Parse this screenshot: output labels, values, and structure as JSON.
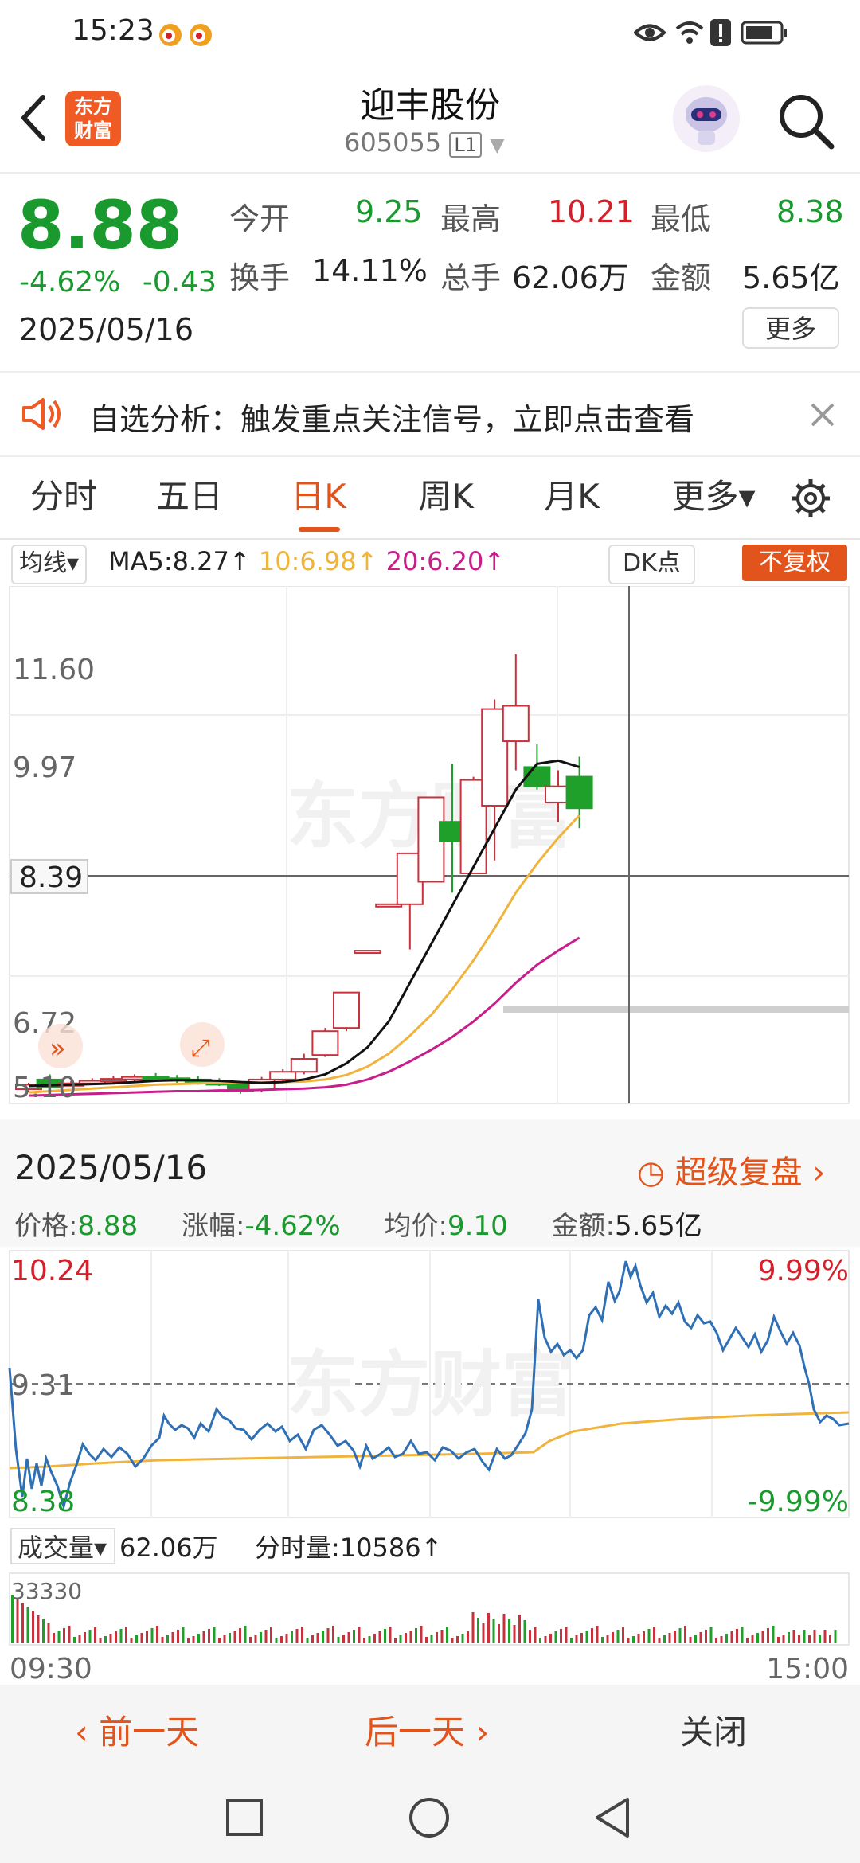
{
  "status_bar": {
    "time": "15:23"
  },
  "header": {
    "title": "迎丰股份",
    "code": "605055",
    "level": "L1",
    "logo_text": [
      "东方",
      "财富"
    ]
  },
  "quote": {
    "price": "8.88",
    "change_pct": "-4.62%",
    "change": "-0.43",
    "date": "2025/05/16",
    "open_label": "今开",
    "open": "9.25",
    "high_label": "最高",
    "high": "10.21",
    "low_label": "最低",
    "low": "8.38",
    "turnover_label": "换手",
    "turnover": "14.11%",
    "volume_label": "总手",
    "volume": "62.06万",
    "amount_label": "金额",
    "amount": "5.65亿",
    "more_button": "更多"
  },
  "notice": {
    "text": "自选分析：触发重点关注信号，立即点击查看"
  },
  "tabs": [
    {
      "label": "分时",
      "active": false
    },
    {
      "label": "五日",
      "active": false
    },
    {
      "label": "日K",
      "active": true
    },
    {
      "label": "周K",
      "active": false
    },
    {
      "label": "月K",
      "active": false
    },
    {
      "label": "更多▾",
      "active": false
    }
  ],
  "kline": {
    "indicator_select": "均线▾",
    "ma5": "MA5:8.27↑",
    "ma10": "10:6.98↑",
    "ma20": "20:6.20↑",
    "dk_button": "DK点",
    "adjust_badge": "不复权",
    "watermark": "东方财富",
    "price_labels": [
      "11.60",
      "9.97",
      "8.39",
      "6.72",
      "5.10"
    ],
    "colors": {
      "up": "#c8323c",
      "down": "#1fa02b",
      "ma5": "#111111",
      "ma10": "#f0b43c",
      "ma20": "#c81e8c"
    }
  },
  "chart_data": {
    "type": "candlestick",
    "y_axis_labels": [
      11.6,
      9.97,
      8.39,
      6.72,
      5.1
    ],
    "crosshair_price": 8.39,
    "candles": [
      {
        "o": 5.05,
        "h": 5.15,
        "l": 5.0,
        "c": 5.12
      },
      {
        "o": 5.2,
        "h": 5.28,
        "l": 5.05,
        "c": 5.08
      },
      {
        "o": 5.12,
        "h": 5.18,
        "l": 5.1,
        "c": 5.14
      },
      {
        "o": 5.14,
        "h": 5.22,
        "l": 5.12,
        "c": 5.18
      },
      {
        "o": 5.18,
        "h": 5.26,
        "l": 5.15,
        "c": 5.21
      },
      {
        "o": 5.21,
        "h": 5.28,
        "l": 5.17,
        "c": 5.24
      },
      {
        "o": 5.24,
        "h": 5.3,
        "l": 5.18,
        "c": 5.22
      },
      {
        "o": 5.22,
        "h": 5.27,
        "l": 5.15,
        "c": 5.2
      },
      {
        "o": 5.2,
        "h": 5.25,
        "l": 5.12,
        "c": 5.16
      },
      {
        "o": 5.16,
        "h": 5.22,
        "l": 5.1,
        "c": 5.12
      },
      {
        "o": 5.12,
        "h": 5.18,
        "l": 4.98,
        "c": 5.02
      },
      {
        "o": 5.04,
        "h": 5.24,
        "l": 5.0,
        "c": 5.2
      },
      {
        "o": 5.2,
        "h": 5.36,
        "l": 5.16,
        "c": 5.32
      },
      {
        "o": 5.32,
        "h": 5.6,
        "l": 5.28,
        "c": 5.52
      },
      {
        "o": 5.58,
        "h": 6.0,
        "l": 5.55,
        "c": 5.95
      },
      {
        "o": 6.0,
        "h": 6.55,
        "l": 5.95,
        "c": 6.55
      },
      {
        "o": 7.2,
        "h": 7.2,
        "l": 7.2,
        "c": 7.2
      },
      {
        "o": 7.92,
        "h": 7.92,
        "l": 7.92,
        "c": 7.92
      },
      {
        "o": 7.92,
        "h": 8.71,
        "l": 7.22,
        "c": 8.71
      },
      {
        "o": 8.27,
        "h": 9.58,
        "l": 8.27,
        "c": 9.58
      },
      {
        "o": 9.2,
        "h": 10.1,
        "l": 8.1,
        "c": 8.9
      },
      {
        "o": 8.4,
        "h": 9.9,
        "l": 8.4,
        "c": 9.85
      },
      {
        "o": 9.45,
        "h": 11.1,
        "l": 8.6,
        "c": 10.95
      },
      {
        "o": 10.45,
        "h": 11.8,
        "l": 10.0,
        "c": 11.0
      },
      {
        "o": 10.05,
        "h": 10.4,
        "l": 9.7,
        "c": 9.75
      },
      {
        "o": 9.5,
        "h": 10.0,
        "l": 9.2,
        "c": 9.75
      },
      {
        "o": 9.9,
        "h": 10.21,
        "l": 9.1,
        "c": 9.41
      }
    ],
    "ma5": [
      5.1,
      5.11,
      5.12,
      5.13,
      5.14,
      5.16,
      5.18,
      5.19,
      5.19,
      5.18,
      5.16,
      5.15,
      5.16,
      5.2,
      5.28,
      5.45,
      5.7,
      6.1,
      6.7,
      7.3,
      7.9,
      8.5,
      9.1,
      9.7,
      10.1,
      10.15,
      10.05
    ],
    "ma10": [
      5.0,
      5.02,
      5.04,
      5.06,
      5.08,
      5.1,
      5.12,
      5.13,
      5.14,
      5.15,
      5.15,
      5.15,
      5.16,
      5.17,
      5.2,
      5.27,
      5.4,
      5.6,
      5.88,
      6.2,
      6.6,
      7.05,
      7.55,
      8.1,
      8.55,
      8.95,
      9.3
    ],
    "ma20": [
      4.95,
      4.96,
      4.97,
      4.98,
      4.99,
      5.0,
      5.01,
      5.02,
      5.02,
      5.03,
      5.03,
      5.04,
      5.05,
      5.06,
      5.08,
      5.12,
      5.2,
      5.32,
      5.48,
      5.66,
      5.86,
      6.1,
      6.38,
      6.7,
      6.98,
      7.2,
      7.4
    ]
  },
  "detail": {
    "date": "2025/05/16",
    "replay_button": "超级复盘",
    "price_label": "价格:",
    "price": "8.88",
    "change_label": "涨幅:",
    "change": "-4.62%",
    "avg_label": "均价:",
    "avg": "9.10",
    "amount_label": "金额:",
    "amount": "5.65亿",
    "y_top": "10.24",
    "y_mid": "9.31",
    "y_bot": "8.38",
    "pct_top": "9.99%",
    "pct_bot": "-9.99%",
    "volume_select": "成交量▾",
    "volume_total": "62.06万",
    "volume_tick_label": "分时量:10586↑",
    "volume_axis": "33330",
    "time_start": "09:30",
    "time_end": "15:00",
    "watermark": "东方财富"
  },
  "footer": {
    "prev_day": "前一天",
    "next_day": "后一天",
    "close": "关闭"
  }
}
